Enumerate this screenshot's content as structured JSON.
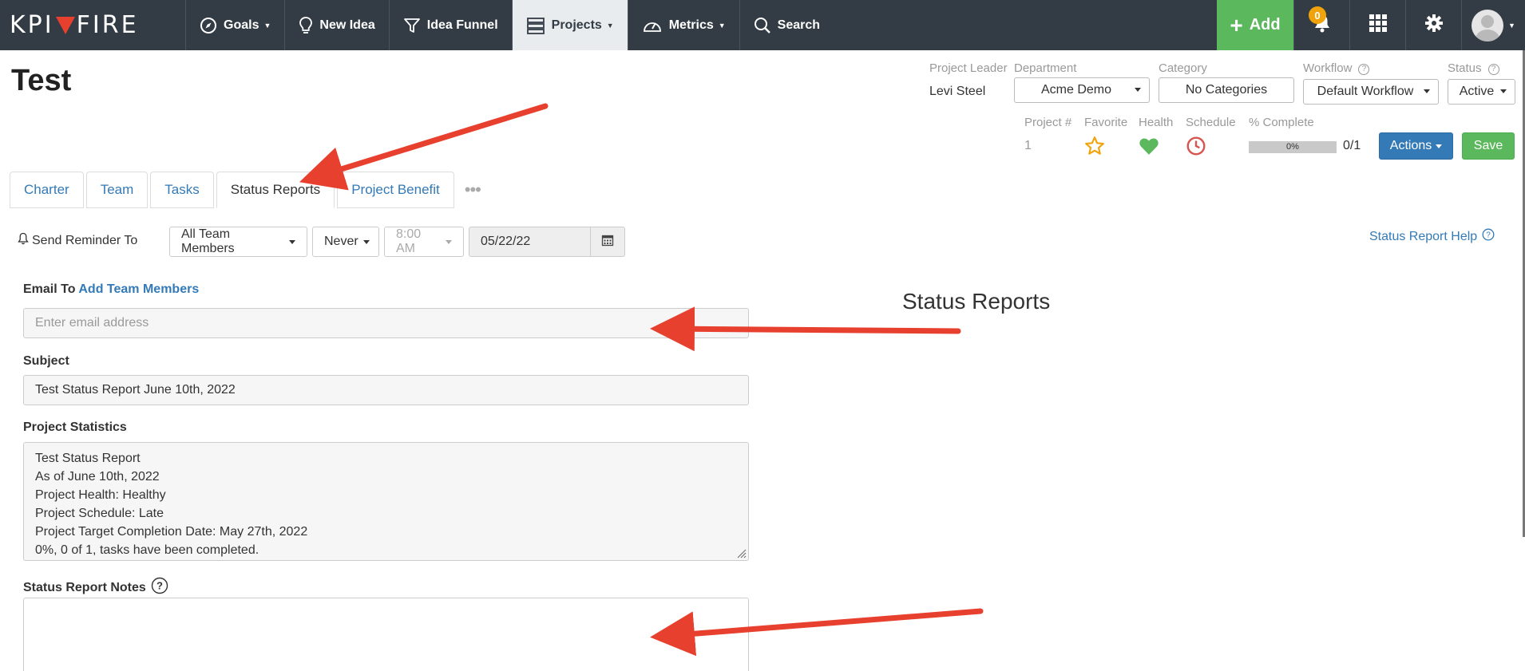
{
  "nav": {
    "logo_left": "KPI",
    "logo_right": "FIRE",
    "items": [
      {
        "label": "Goals",
        "has_caret": true
      },
      {
        "label": "New Idea",
        "has_caret": false
      },
      {
        "label": "Idea Funnel",
        "has_caret": false
      },
      {
        "label": "Projects",
        "has_caret": true
      },
      {
        "label": "Metrics",
        "has_caret": true
      },
      {
        "label": "Search",
        "has_caret": false
      }
    ],
    "add_label": "Add",
    "notification_count": "0"
  },
  "project": {
    "title": "Test",
    "leader_label": "Project Leader",
    "leader": "Levi Steel",
    "department_label": "Department",
    "department": "Acme Demo",
    "category_label": "Category",
    "category": "No Categories",
    "workflow_label": "Workflow",
    "workflow": "Default Workflow",
    "status_label": "Status",
    "status": "Active",
    "number_label": "Project #",
    "number": "1",
    "favorite_label": "Favorite",
    "health_label": "Health",
    "schedule_label": "Schedule",
    "complete_label": "% Complete",
    "complete_pct": "0%",
    "complete_fraction": 0,
    "tasks_ratio": "0/1",
    "actions_label": "Actions",
    "save_label": "Save"
  },
  "tabs": [
    {
      "label": "Charter"
    },
    {
      "label": "Team"
    },
    {
      "label": "Tasks"
    },
    {
      "label": "Status Reports"
    },
    {
      "label": "Project Benefit"
    }
  ],
  "tabs_more": "•••",
  "reminder": {
    "label": "Send Reminder To",
    "recipients": "All Team Members",
    "frequency": "Never",
    "time": "8:00 AM",
    "date": "05/22/22",
    "help_link": "Status Report Help"
  },
  "form": {
    "email_label": "Email To",
    "add_members_link": "Add Team Members",
    "email_placeholder": "Enter email address",
    "subject_label": "Subject",
    "subject_value": "Test Status Report June 10th, 2022",
    "stats_label": "Project Statistics",
    "stats_lines": [
      "Test Status Report",
      "As of June 10th, 2022",
      "Project Health: Healthy",
      "Project Schedule: Late",
      "Project Target Completion Date: May 27th, 2022",
      "0%, 0 of 1, tasks have been completed."
    ],
    "notes_label": "Status Report Notes"
  },
  "annotation_heading": "Status Reports",
  "colors": {
    "nav_bg": "#333c45",
    "accent_blue": "#337ab7",
    "success_green": "#5cb85c",
    "health_green": "#5cb85c",
    "schedule_red": "#d9534f",
    "favorite_orange": "#f0a30a",
    "arrow_red": "#e8402e"
  }
}
